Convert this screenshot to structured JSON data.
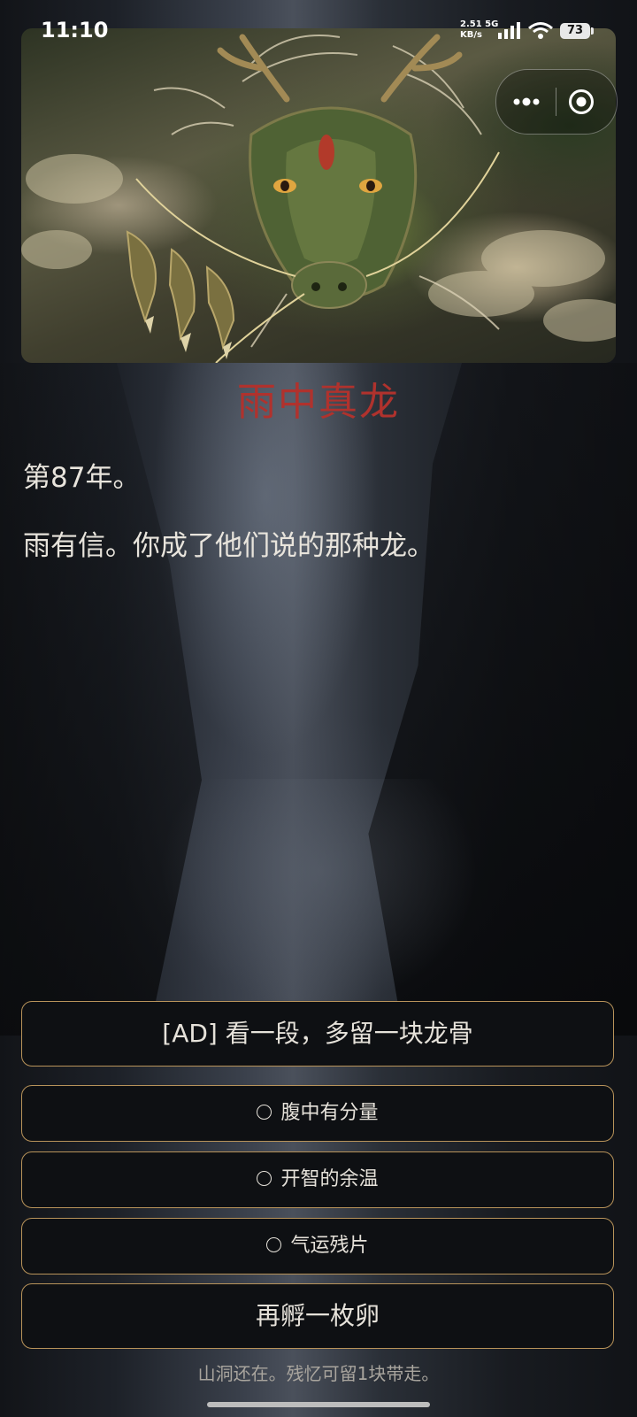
{
  "status_bar": {
    "time": "11:10",
    "net_speed_value": "2.51",
    "net_speed_unit": "KB/s",
    "network_type": "5G",
    "battery": "73",
    "icons": [
      "signal-icon",
      "wifi-icon",
      "battery-icon"
    ]
  },
  "capsule": {
    "icons": [
      "more-icon",
      "close-target-icon"
    ]
  },
  "banner": {
    "image": "dragon-illustration"
  },
  "scene": {
    "title": "雨中真龙",
    "title_color": "#b0322d",
    "lines": [
      "第87年。",
      "雨有信。你成了他们说的那种龙。"
    ]
  },
  "actions": {
    "ad_button": "[AD] 看一段，多留一块龙骨",
    "options": [
      "腹中有分量",
      "开智的余温",
      "气运残片"
    ],
    "hatch_button": "再孵一枚卵"
  },
  "footer": {
    "text": "山洞还在。残忆可留1块带走。"
  },
  "colors": {
    "accent_border": "#b8935a",
    "button_bg": "#0e1013",
    "text": "#e6e2da"
  }
}
